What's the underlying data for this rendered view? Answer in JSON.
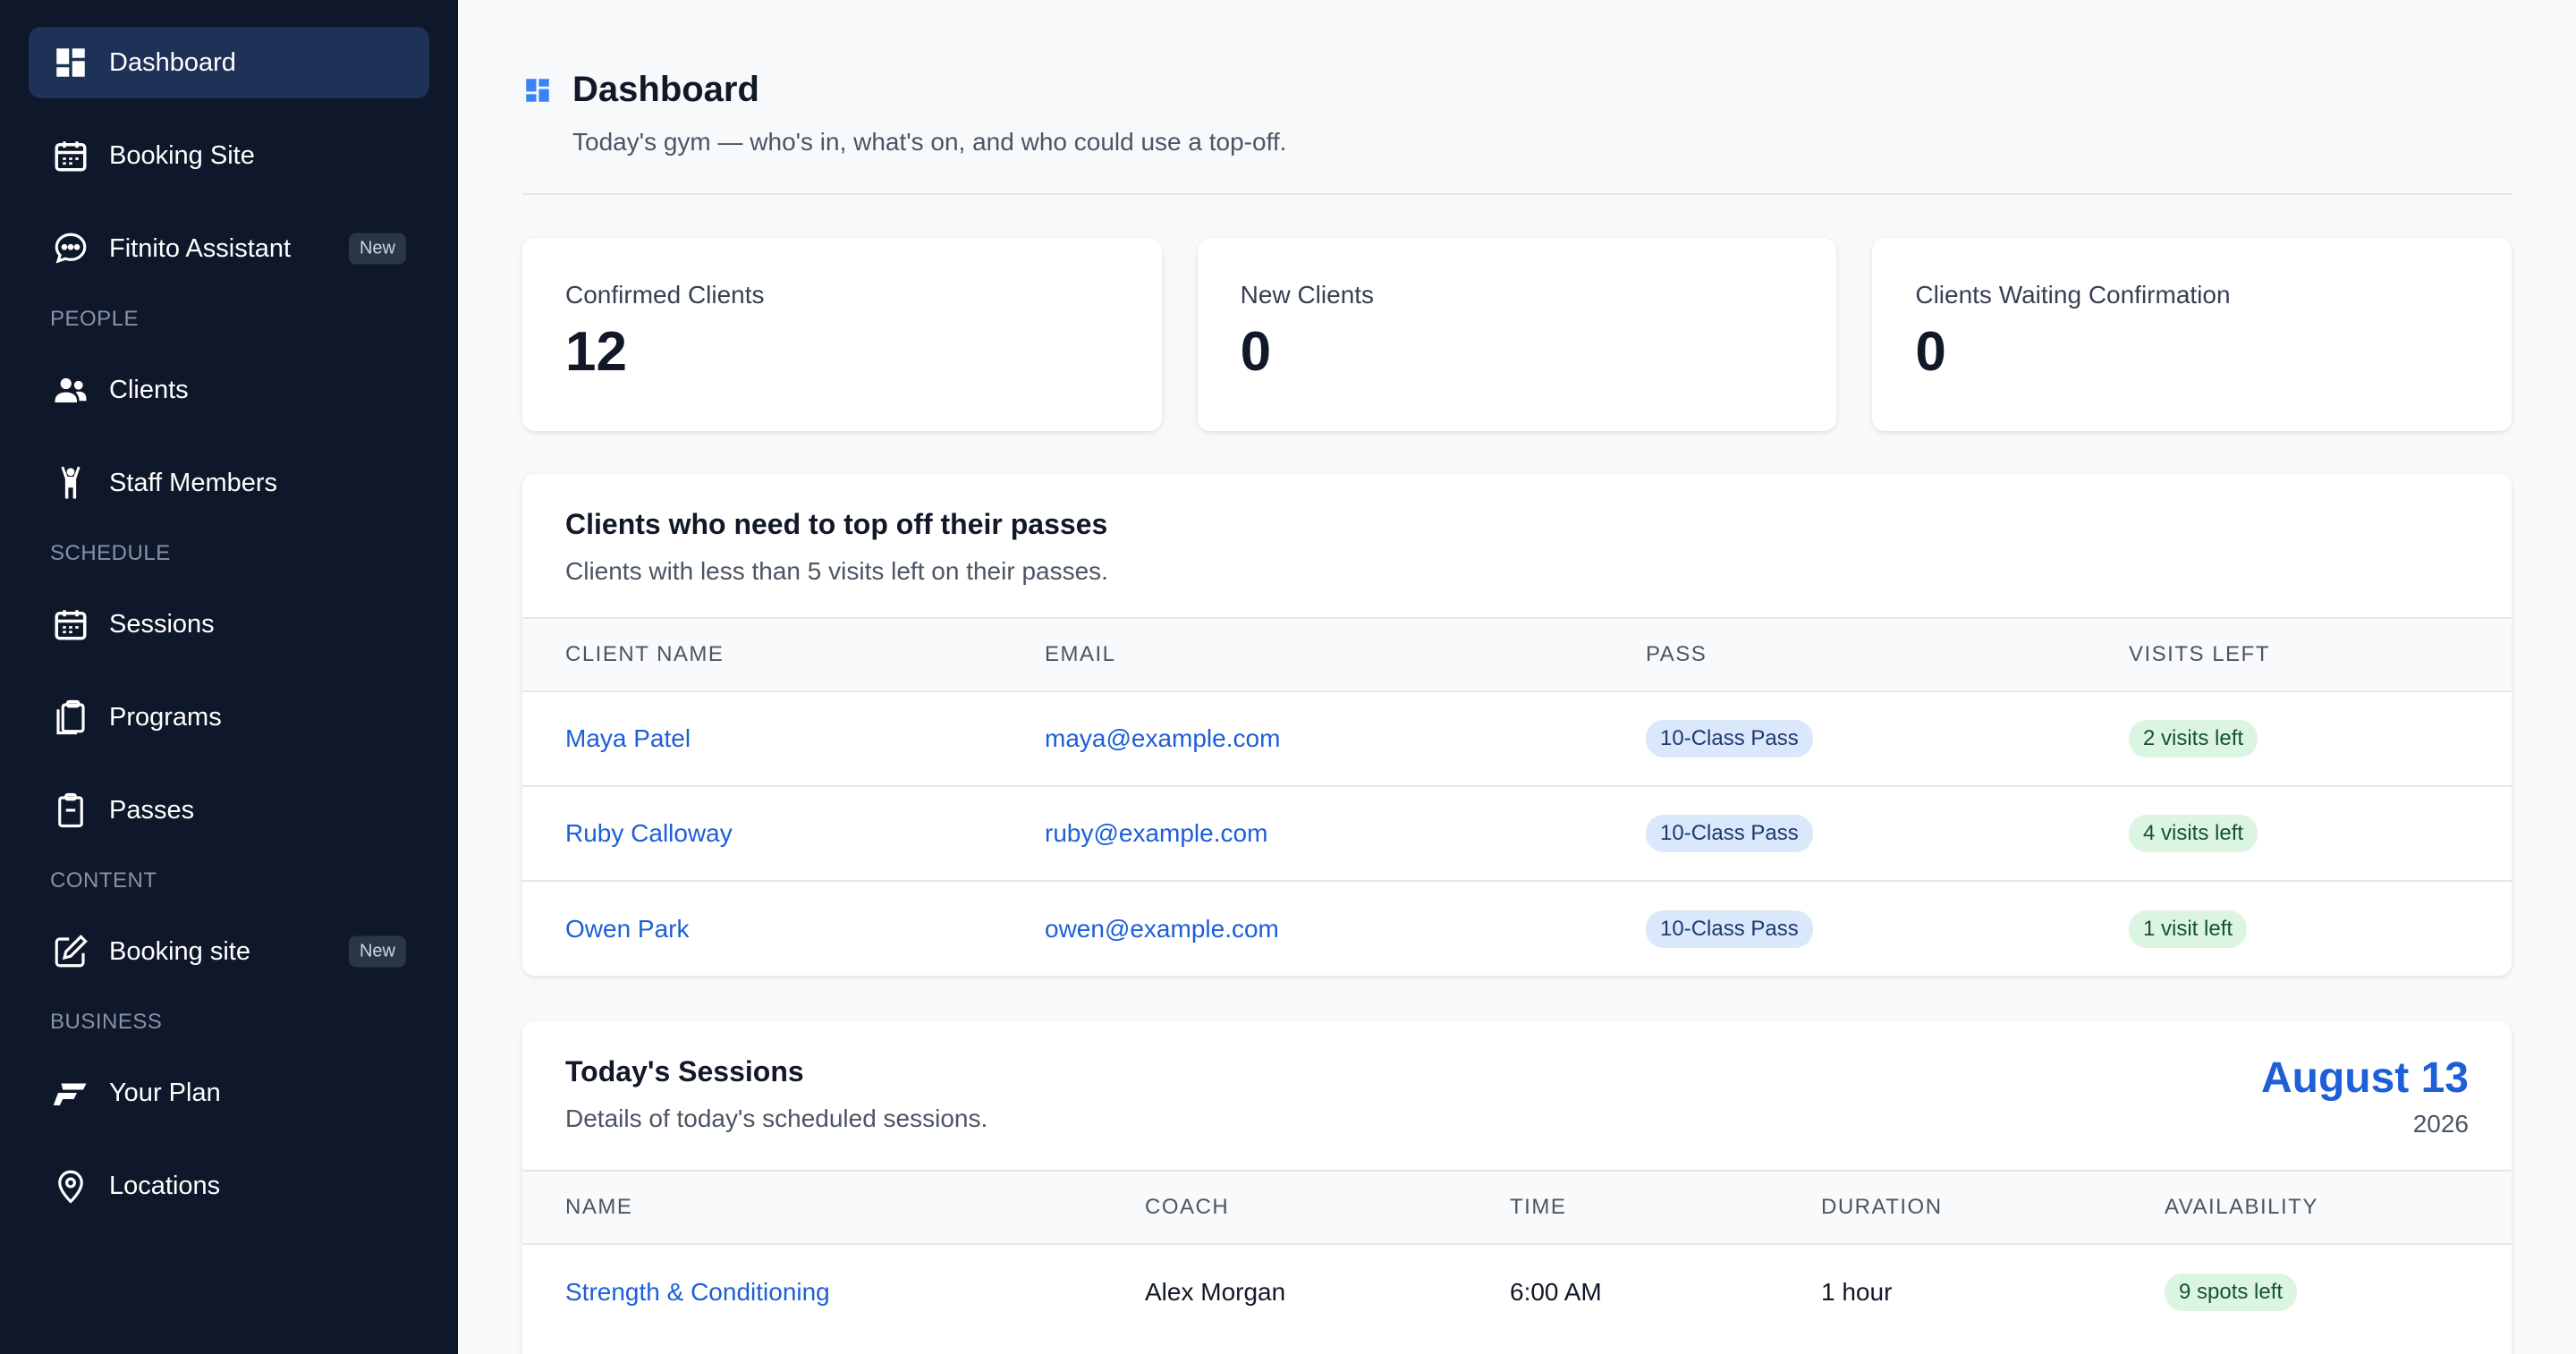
{
  "sidebar": {
    "top_items": [
      {
        "label": "Dashboard"
      },
      {
        "label": "Booking Site"
      },
      {
        "label": "Fitnito Assistant",
        "badge": "New"
      }
    ],
    "sections": [
      {
        "label": "PEOPLE",
        "items": [
          {
            "label": "Clients"
          },
          {
            "label": "Staff Members"
          }
        ]
      },
      {
        "label": "SCHEDULE",
        "items": [
          {
            "label": "Sessions"
          },
          {
            "label": "Programs"
          },
          {
            "label": "Passes"
          }
        ]
      },
      {
        "label": "CONTENT",
        "items": [
          {
            "label": "Booking site",
            "badge": "New"
          }
        ]
      },
      {
        "label": "BUSINESS",
        "items": [
          {
            "label": "Your Plan"
          },
          {
            "label": "Locations"
          }
        ]
      }
    ]
  },
  "header": {
    "title": "Dashboard",
    "subtitle": "Today's gym — who's in, what's on, and who could use a top-off."
  },
  "stats": [
    {
      "label": "Confirmed Clients",
      "value": "12"
    },
    {
      "label": "New Clients",
      "value": "0"
    },
    {
      "label": "Clients Waiting Confirmation",
      "value": "0"
    }
  ],
  "topoff": {
    "title": "Clients who need to top off their passes",
    "subtitle": "Clients with less than 5 visits left on their passes.",
    "columns": [
      "CLIENT NAME",
      "EMAIL",
      "PASS",
      "VISITS LEFT"
    ],
    "rows": [
      {
        "name": "Maya Patel",
        "email": "maya@example.com",
        "pass": "10-Class Pass",
        "visits": "2 visits left"
      },
      {
        "name": "Ruby Calloway",
        "email": "ruby@example.com",
        "pass": "10-Class Pass",
        "visits": "4 visits left"
      },
      {
        "name": "Owen Park",
        "email": "owen@example.com",
        "pass": "10-Class Pass",
        "visits": "1 visit left"
      }
    ]
  },
  "sessions": {
    "title": "Today's Sessions",
    "subtitle": "Details of today's scheduled sessions.",
    "date": "August 13",
    "year": "2026",
    "columns": [
      "NAME",
      "COACH",
      "TIME",
      "DURATION",
      "AVAILABILITY"
    ],
    "rows": [
      {
        "name": "Strength & Conditioning",
        "coach": "Alex Morgan",
        "time": "6:00 AM",
        "duration": "1 hour",
        "availability": "9 spots left"
      }
    ]
  }
}
